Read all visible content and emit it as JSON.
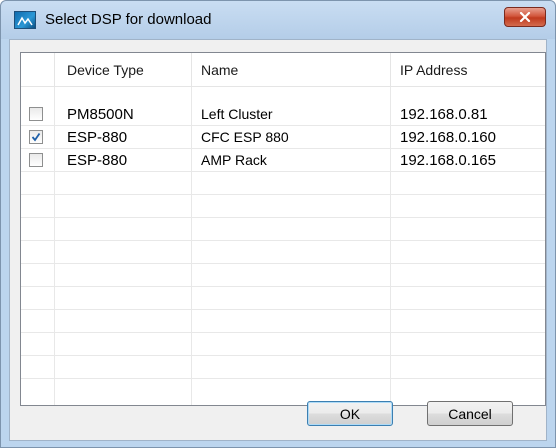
{
  "window": {
    "title": "Select DSP for download"
  },
  "table": {
    "columns": [
      "",
      "Device Type",
      "Name",
      "IP Address"
    ],
    "rows": [
      {
        "checked": false,
        "device_type": "PM8500N",
        "name": "Left Cluster",
        "ip": "192.168.0.81"
      },
      {
        "checked": true,
        "device_type": "ESP-880",
        "name": "CFC ESP 880",
        "ip": "192.168.0.160"
      },
      {
        "checked": false,
        "device_type": "ESP-880",
        "name": "AMP Rack",
        "ip": "192.168.0.165"
      }
    ]
  },
  "buttons": {
    "ok": "OK",
    "cancel": "Cancel"
  },
  "colors": {
    "titlebar": "#bcd5ee",
    "close": "#c7442a",
    "check": "#1d5fa8"
  }
}
